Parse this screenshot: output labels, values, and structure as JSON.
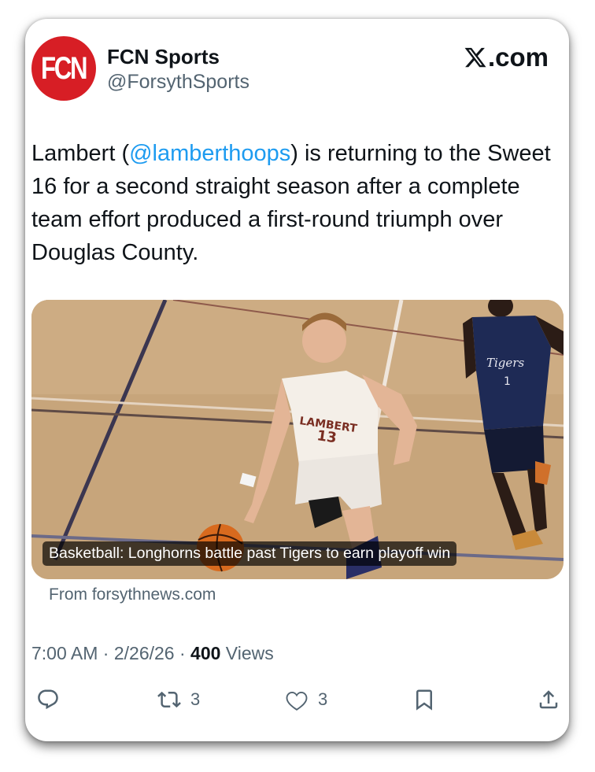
{
  "author": {
    "name": "FCN Sports",
    "handle": "@ForsythSports",
    "avatar_text": "FCN"
  },
  "brand": {
    "site": ".com"
  },
  "tweet": {
    "text_before": "Lambert (",
    "mention": "@lamberthoops",
    "text_after": ") is returning to the Sweet 16 for a second straight season after a complete team effort produced a first-round triumph over Douglas County."
  },
  "media": {
    "caption": "Basketball: Longhorns battle past Tigers to earn playoff win",
    "source": "From forsythnews.com",
    "jersey_home": "LAMBERT",
    "jersey_home_number": "13",
    "jersey_away": "Tigers",
    "jersey_away_number": "1"
  },
  "meta": {
    "time": "7:00 AM",
    "separator": " · ",
    "date": "2/26/26",
    "views_count": "400",
    "views_label": " Views"
  },
  "actions": {
    "reposts": "3",
    "likes": "3"
  },
  "colors": {
    "accent": "#1d9bf0",
    "brand_red": "#d71e25",
    "text": "#0f1419",
    "muted": "#536471"
  }
}
